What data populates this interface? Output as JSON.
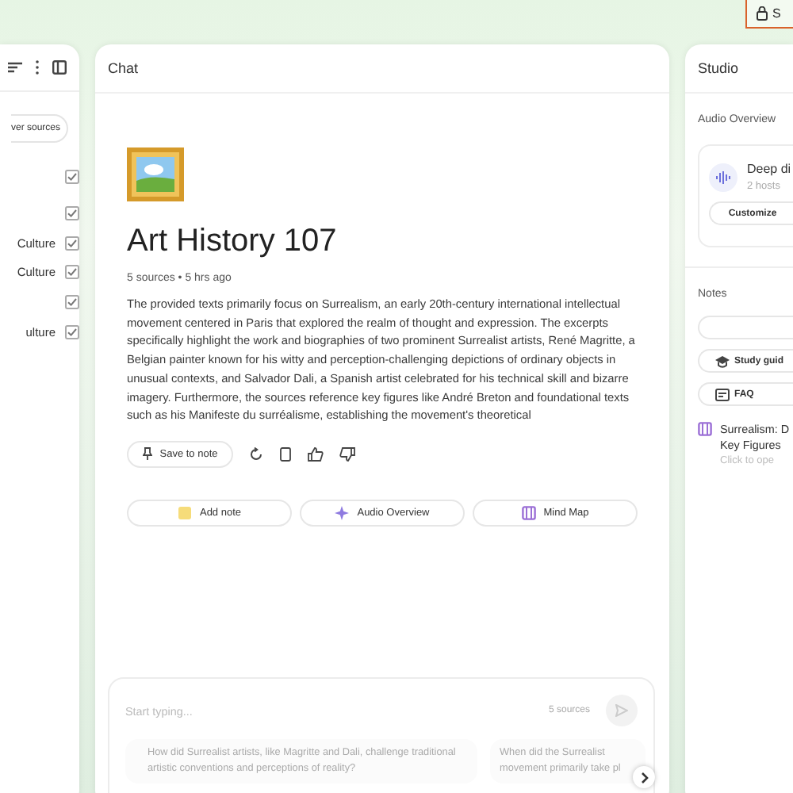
{
  "top_button": {
    "label": "S"
  },
  "sources": {
    "discover_button": "ver sources",
    "items": [
      {
        "checked": true
      },
      {
        "checked": true
      },
      {
        "label": "Culture",
        "checked": true
      },
      {
        "label": "Culture",
        "checked": true
      },
      {
        "checked": true
      },
      {
        "label": "ulture",
        "checked": true
      }
    ]
  },
  "chat": {
    "title": "Chat",
    "notebook_title": "Art History 107",
    "meta": "5 sources • 5 hrs ago",
    "summary": "The provided texts primarily focus on Surrealism, an early 20th-century international intellectual movement centered in Paris that explored the realm of thought and expression. The excerpts specifically highlight the work and biographies of two prominent Surrealist artists, René Magritte, a Belgian painter known for his witty and perception-challenging depictions of ordinary objects in unusual contexts, and Salvador Dali, a Spanish artist celebrated for his technical skill and bizarre imagery. Furthermore, the sources reference key figures like André Breton and foundational texts such as his Manifeste du surréalisme, establishing the movement's theoretical",
    "save_button": "Save to note",
    "shortcuts": [
      {
        "kind": "note",
        "label": "Add note"
      },
      {
        "kind": "audio",
        "label": "Audio Overview"
      },
      {
        "kind": "mindmap",
        "label": "Mind Map"
      }
    ],
    "input": {
      "placeholder": "Start typing...",
      "source_count": "5 sources"
    },
    "suggestions": [
      "How did Surrealist artists, like Magritte and Dali, challenge traditional artistic conventions and perceptions of reality?",
      "When did the Surrealist movement primarily take pl"
    ]
  },
  "studio": {
    "title": "Studio",
    "audio_section": "Audio Overview",
    "audio_card": {
      "title": "Deep di",
      "subtitle": "2 hosts",
      "button": "Customize"
    },
    "notes_section": "Notes",
    "note_buttons": [
      {
        "kind": "study",
        "label": "Study guid"
      },
      {
        "kind": "faq",
        "label": "FAQ"
      }
    ],
    "notes": [
      {
        "title": "Surrealism: D",
        "title_2": "Key Figures",
        "hint": "Click to ope"
      }
    ]
  }
}
